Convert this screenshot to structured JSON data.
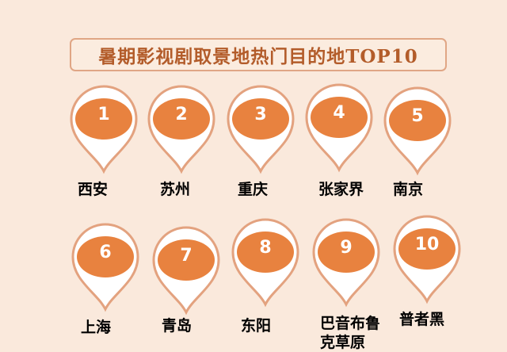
{
  "title": "暑期影视剧取景地热门目的地TOP10",
  "colors": {
    "accent": "#e8823f",
    "pin_border": "#e3a27f",
    "title_text": "#b35c2a",
    "background": "#fae9dc"
  },
  "destinations": [
    {
      "rank": "1",
      "city": "西安"
    },
    {
      "rank": "2",
      "city": "苏州"
    },
    {
      "rank": "3",
      "city": "重庆"
    },
    {
      "rank": "4",
      "city": "张家界"
    },
    {
      "rank": "5",
      "city": "南京"
    },
    {
      "rank": "6",
      "city": "上海"
    },
    {
      "rank": "7",
      "city": "青岛"
    },
    {
      "rank": "8",
      "city": "东阳"
    },
    {
      "rank": "9",
      "city": "巴音布鲁克草原"
    },
    {
      "rank": "10",
      "city": "普者黑"
    }
  ]
}
